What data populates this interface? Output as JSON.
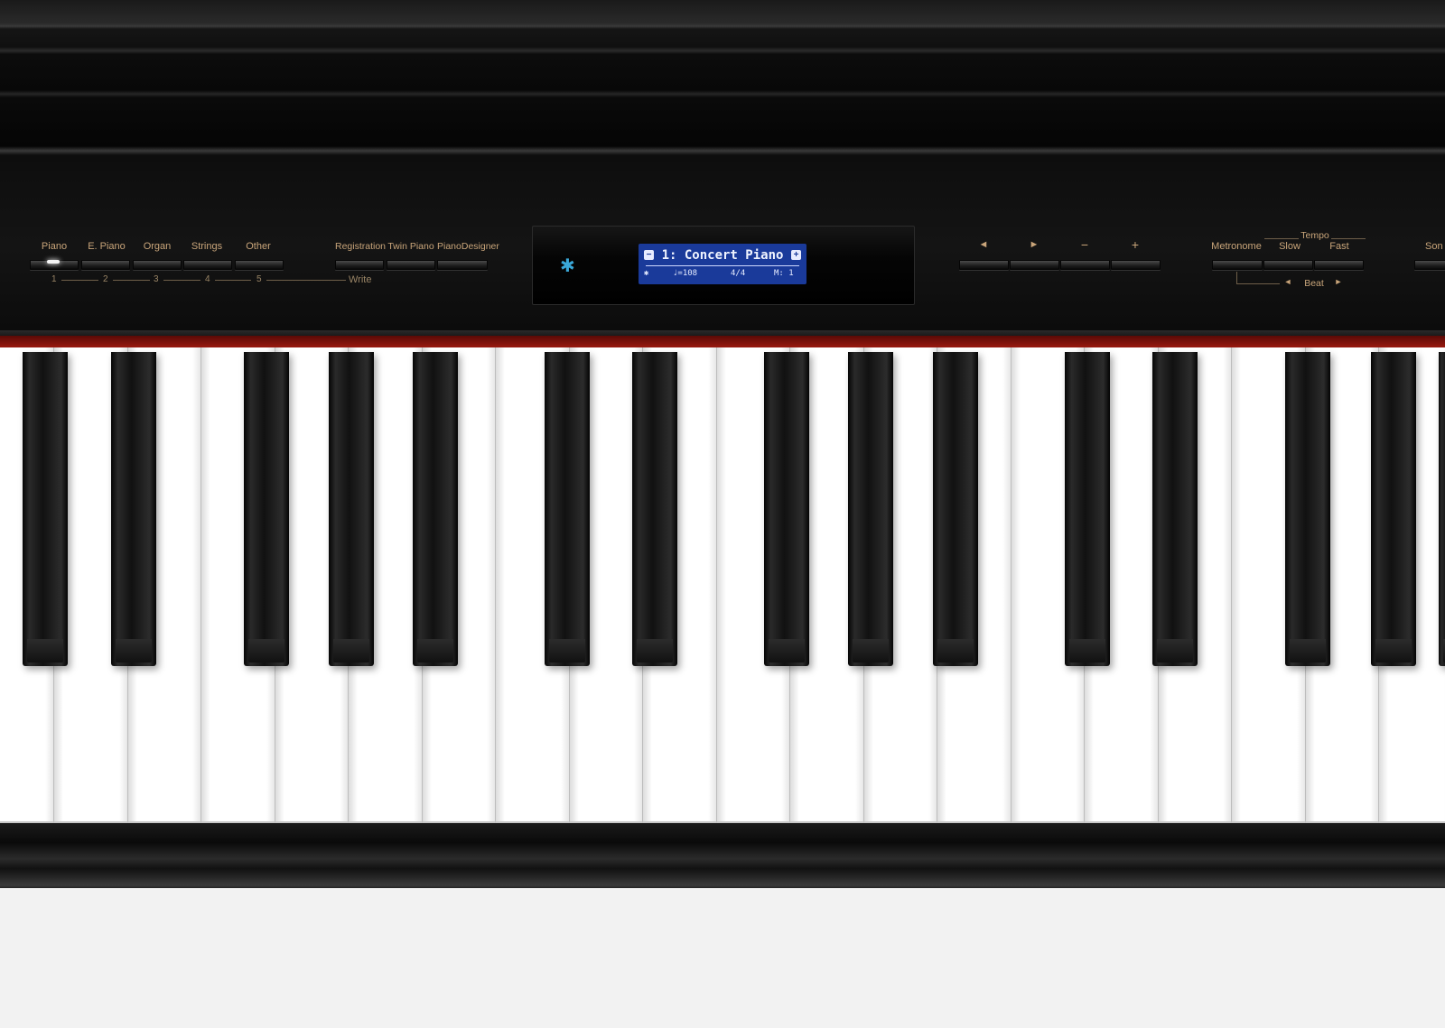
{
  "tone_buttons": [
    {
      "label": "Piano",
      "number": "1"
    },
    {
      "label": "E. Piano",
      "number": "2"
    },
    {
      "label": "Organ",
      "number": "3"
    },
    {
      "label": "Strings",
      "number": "4"
    },
    {
      "label": "Other",
      "number": "5"
    }
  ],
  "function_buttons": [
    {
      "label": "Registration"
    },
    {
      "label": "Twin Piano"
    },
    {
      "label": "PianoDesigner"
    }
  ],
  "write_label": "Write",
  "display": {
    "minus_symbol": "−",
    "plus_symbol": "+",
    "title": "1: Concert Piano",
    "bluetooth_symbol": "✱",
    "tempo": "♩=108",
    "time_signature": "4/4",
    "measure": "M: 1"
  },
  "bluetooth_icon": "✱",
  "cursor_buttons": [
    {
      "label": "◄"
    },
    {
      "label": "►"
    },
    {
      "label": "−"
    },
    {
      "label": "+"
    }
  ],
  "metronome": {
    "metronome_label": "Metronome",
    "tempo_label": "Tempo",
    "slow_label": "Slow",
    "fast_label": "Fast",
    "beat_label": "Beat",
    "beat_left": "◄",
    "beat_right": "►"
  },
  "cut_off_label": "Son",
  "colors": {
    "panel_label": "#c9a57a",
    "lcd_background": "#1a3a9a",
    "bluetooth": "#3aa8d8",
    "felt": "#9a1a10"
  },
  "keyboard": {
    "white_key_count": 20,
    "black_key_count": 15
  }
}
